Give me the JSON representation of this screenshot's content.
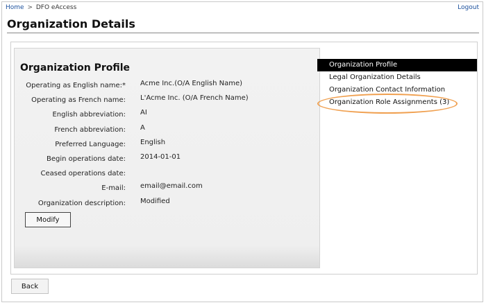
{
  "breadcrumb": {
    "home": "Home",
    "separator": ">",
    "current": "DFO eAccess"
  },
  "header": {
    "logout_label": "Logout",
    "page_title": "Organization Details"
  },
  "profile": {
    "title": "Organization Profile",
    "fields": [
      {
        "label": "Operating as English name:*",
        "value": "Acme Inc.(O/A English Name)"
      },
      {
        "label": "Operating as French name:",
        "value": "L'Acme Inc. (O/A French Name)"
      },
      {
        "label": "English abbreviation:",
        "value": "AI"
      },
      {
        "label": "French abbreviation:",
        "value": "A"
      },
      {
        "label": "Preferred Language:",
        "value": "English"
      },
      {
        "label": "Begin operations date:",
        "value": "2014-01-01"
      },
      {
        "label": "Ceased operations date:",
        "value": ""
      },
      {
        "label": "E-mail:",
        "value": "email@email.com"
      },
      {
        "label": "Organization description:",
        "value": "Modified"
      }
    ],
    "modify_label": "Modify"
  },
  "side_nav": {
    "items": [
      {
        "label": "Organization Profile",
        "active": true
      },
      {
        "label": "Legal Organization Details",
        "active": false
      },
      {
        "label": "Organization Contact Information",
        "active": false
      },
      {
        "label": "Organization Role Assignments (3)",
        "active": false
      }
    ]
  },
  "footer": {
    "back_label": "Back"
  },
  "colors": {
    "highlight": "#f0a050",
    "link": "#1a4f9c",
    "active_nav": "#000000"
  }
}
